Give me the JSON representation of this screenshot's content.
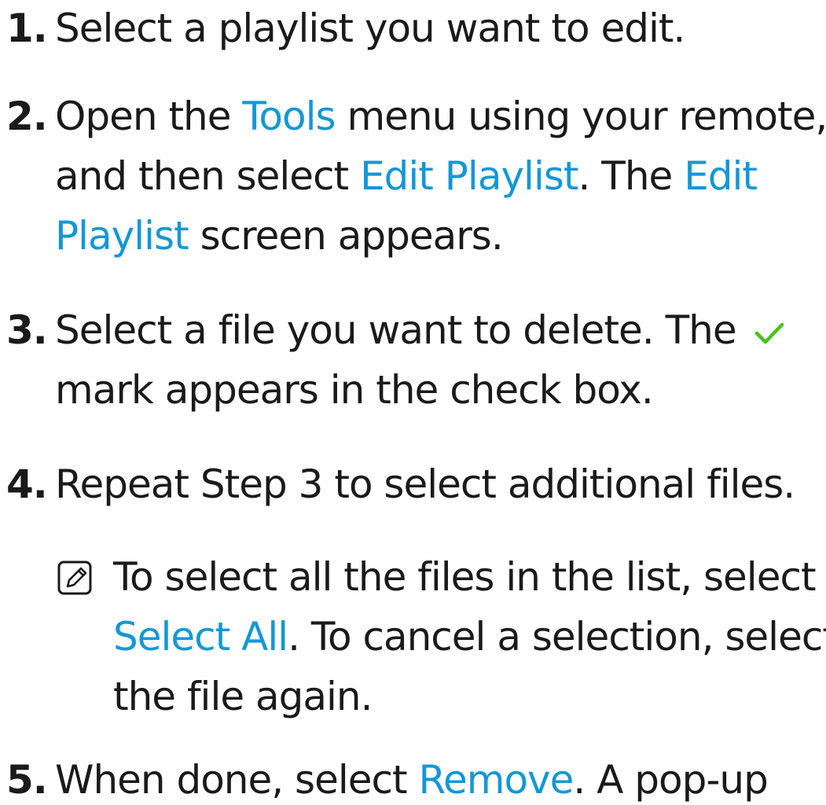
{
  "steps": [
    {
      "num": "1.",
      "lines": [
        "Select a playlist you want to edit."
      ]
    },
    {
      "num": "2.",
      "line1": {
        "a": "Open the ",
        "b": "Tools",
        "c": " menu using your remote,"
      },
      "line2": {
        "a": "and then select ",
        "b": "Edit Playlist",
        "c": ". The ",
        "d": "Edit"
      },
      "line3": {
        "a": "Playlist",
        "b": " screen appears."
      }
    },
    {
      "num": "3.",
      "line1": "Select a file you want to delete. The",
      "line2": "mark appears in the check box."
    },
    {
      "num": "4.",
      "lines": [
        "Repeat Step 3 to select additional files."
      ]
    },
    {
      "num": "5.",
      "line1": {
        "a": "When done, select ",
        "b": "Remove",
        "c": ". A pop-up"
      }
    }
  ],
  "note": {
    "icon": "note-pencil-icon",
    "line1": "To select all the files in the list, select",
    "line2": {
      "a": "Select All",
      "b": ". To cancel a selection, select"
    },
    "line3": "the file again."
  },
  "colors": {
    "highlight": "#1597d6",
    "check": "#46c31e",
    "text": "#1a1a1a"
  },
  "icons": {
    "check": "check-mark-icon"
  }
}
